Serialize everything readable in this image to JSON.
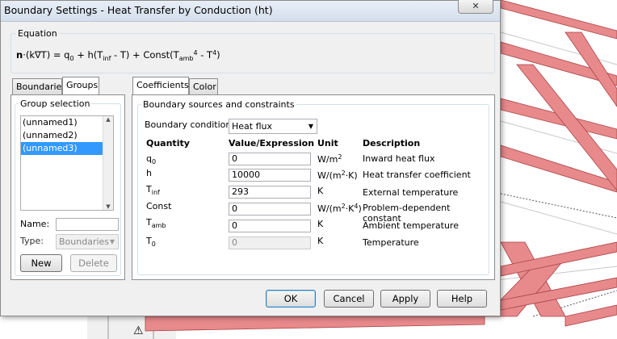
{
  "window": {
    "title": "Boundary Settings - Heat Transfer by Conduction (ht)"
  },
  "equation": {
    "group_label": "Equation",
    "lhs_n": "n",
    "lhs_rest": "·(k∇T) = q",
    "q_sub": "0",
    "mid1": " + h(T",
    "inf_sub": "inf",
    "mid2": " - T) + Const(T",
    "amb_sub": "amb",
    "sup4a": "4",
    "mid3": " - T",
    "sup4b": "4",
    "end": ")"
  },
  "left_tabs": [
    {
      "label": "Boundaries"
    },
    {
      "label": "Groups"
    }
  ],
  "group_selection": {
    "label": "Group selection",
    "items": [
      "(unnamed1)",
      "(unnamed2)",
      "(unnamed3)"
    ],
    "selected": "(unnamed3)",
    "name_label": "Name:",
    "name_value": "",
    "type_label": "Type:",
    "type_value": "Boundaries",
    "new_button": "New",
    "delete_button": "Delete"
  },
  "right_tabs": [
    {
      "label": "Coefficients"
    },
    {
      "label": "Color"
    }
  ],
  "sources": {
    "group_label": "Boundary sources and constraints",
    "condition_label": "Boundary condition:",
    "condition_value": "Heat flux",
    "headers": {
      "quantity": "Quantity",
      "value": "Value/Expression",
      "unit": "Unit",
      "description": "Description"
    },
    "rows": [
      {
        "q_main": "q",
        "q_sub": "0",
        "value": "0",
        "unit_main": "W/m",
        "unit_sup": "2",
        "unit_end": "",
        "description": "Inward heat flux",
        "disabled": false
      },
      {
        "q_main": "h",
        "q_sub": "",
        "value": "10000",
        "unit_main": "W/(m",
        "unit_sup": "2",
        "unit_end": "·K)",
        "description": "Heat transfer coefficient",
        "disabled": false
      },
      {
        "q_main": "T",
        "q_sub": "inf",
        "value": "293",
        "unit_main": "K",
        "unit_sup": "",
        "unit_end": "",
        "description": "External temperature",
        "disabled": false
      },
      {
        "q_main": "Const",
        "q_sub": "",
        "value": "0",
        "unit_main": "W/(m",
        "unit_sup": "2",
        "unit_end": "·K",
        "unit_sup2": "4",
        "unit_end2": ")",
        "description": "Problem-dependent constant",
        "disabled": false
      },
      {
        "q_main": "T",
        "q_sub": "amb",
        "value": "0",
        "unit_main": "K",
        "unit_sup": "",
        "unit_end": "",
        "description": "Ambient temperature",
        "disabled": false
      },
      {
        "q_main": "T",
        "q_sub": "0",
        "value": "0",
        "unit_main": "K",
        "unit_sup": "",
        "unit_end": "",
        "description": "Temperature",
        "disabled": true
      }
    ]
  },
  "buttons": {
    "ok": "OK",
    "cancel": "Cancel",
    "apply": "Apply",
    "help": "Help"
  },
  "close_glyph": "✕",
  "colors": {
    "beam": "#e8898c",
    "selection": "#3399ff"
  }
}
